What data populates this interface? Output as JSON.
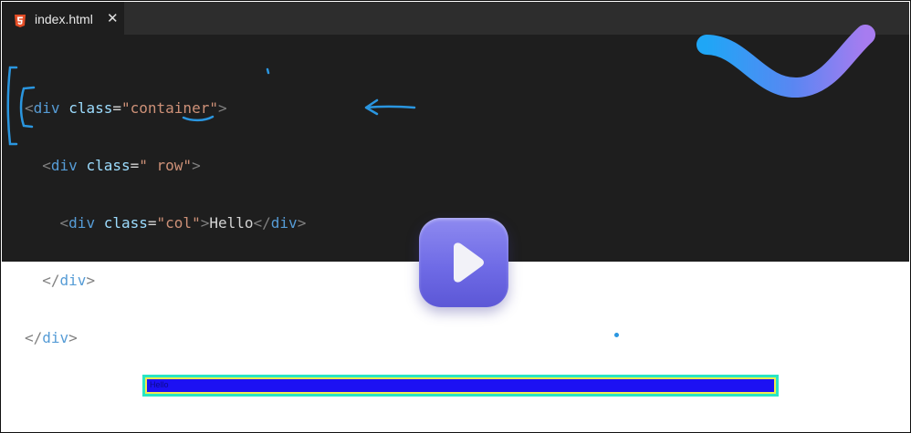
{
  "tab": {
    "label": "index.html",
    "icon": "html5-icon",
    "close_icon": "close-icon"
  },
  "code": {
    "line1": {
      "open": "<",
      "tag": "div",
      "attr": "class",
      "eq": "=",
      "value": "\"container\"",
      "close": ">"
    },
    "line2": {
      "open": "<",
      "tag": "div",
      "attr": "class",
      "eq": "=",
      "value": "\" row\"",
      "close": ">"
    },
    "line3": {
      "open": "<",
      "tag": "div",
      "attr": "class",
      "eq": "=",
      "value": "\"col\"",
      "close": ">",
      "text": "Hello",
      "end_open": "</",
      "end_tag": "div",
      "end_close": ">"
    },
    "line4": {
      "end_open": "</",
      "end_tag": "div",
      "end_close": ">"
    },
    "line5": {
      "end_open": "</",
      "end_tag": "div",
      "end_close": ">"
    }
  },
  "preview": {
    "text": "Hello"
  },
  "colors": {
    "editor_bg": "#1e1e1e",
    "annotation": "#2a96e0",
    "play_button": "#7470e8",
    "preview_row": "#1c11f3",
    "preview_border": "#29e6c4"
  },
  "icons": [
    "html5-icon",
    "close-icon",
    "play-icon",
    "arrow-left-icon"
  ]
}
